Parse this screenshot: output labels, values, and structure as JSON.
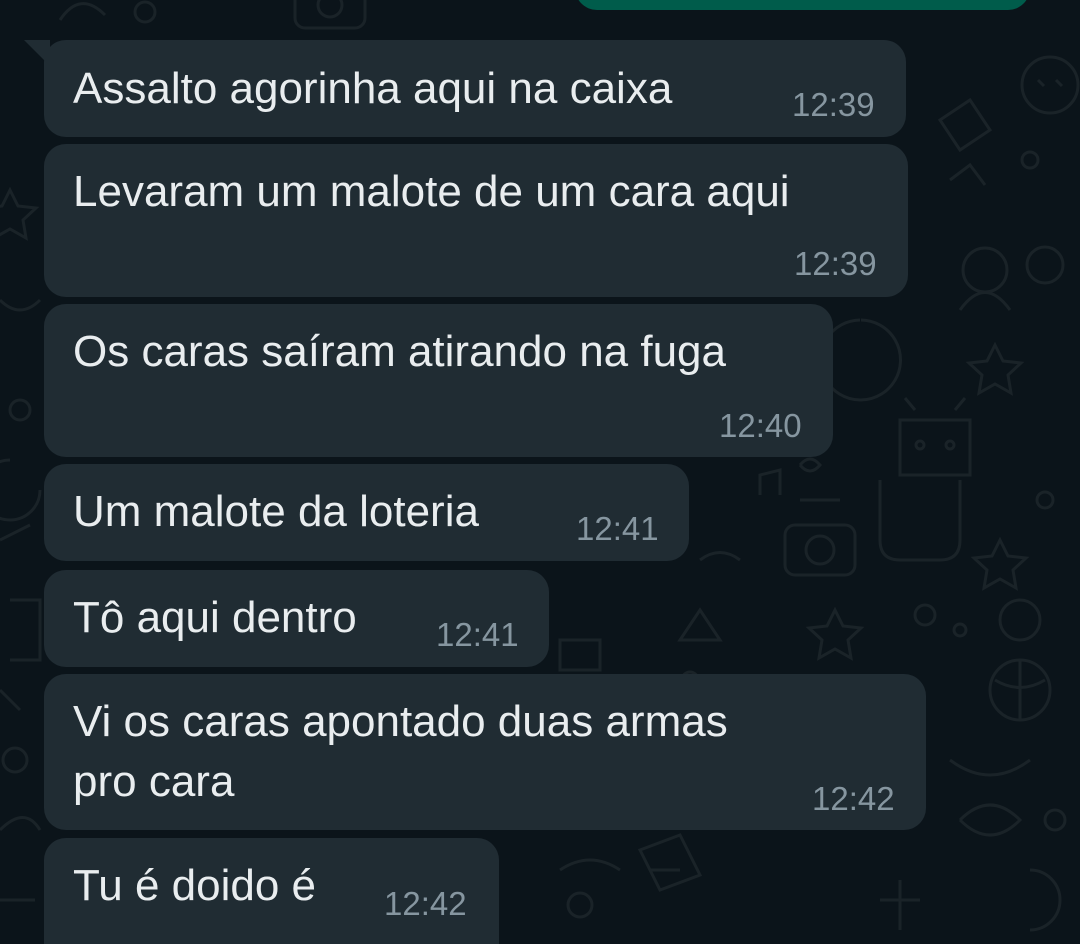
{
  "conversation": {
    "messages": [
      {
        "text": "Assalto agorinha aqui na caixa",
        "time": "12:39"
      },
      {
        "text": "Levaram um malote de um cara aqui",
        "time": "12:39"
      },
      {
        "text": "Os caras saíram atirando na fuga",
        "time": "12:40"
      },
      {
        "text": "Um malote da loteria",
        "time": "12:41"
      },
      {
        "text": "Tô aqui dentro",
        "time": "12:41"
      },
      {
        "text": "Vi os caras apontado duas armas\npro cara",
        "time": "12:42"
      },
      {
        "text": "Tu é doido é",
        "time": "12:42"
      }
    ]
  },
  "colors": {
    "background": "#0b141a",
    "incoming_bubble": "#202c33",
    "outgoing_bubble": "#005c4b",
    "message_text": "#e9edef",
    "timestamp_text": "#8696a0"
  }
}
